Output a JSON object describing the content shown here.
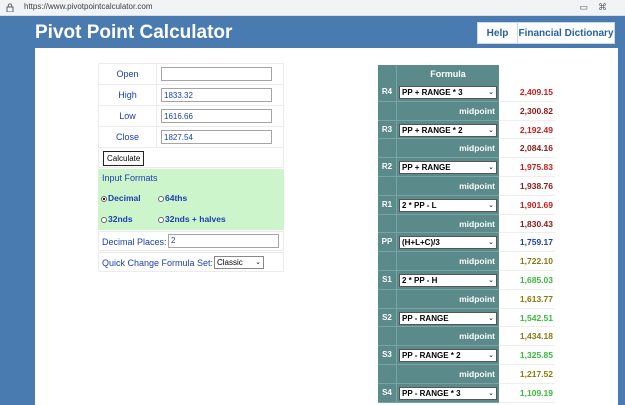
{
  "browser": {
    "url": "https://www.pivotpointcalculator.com"
  },
  "header": {
    "title": "Pivot Point Calculator",
    "nav": [
      "Help",
      "Financial Dictionary"
    ]
  },
  "form": {
    "fields": [
      {
        "label": "Open",
        "value": ""
      },
      {
        "label": "High",
        "value": "1833.32"
      },
      {
        "label": "Low",
        "value": "1616.66"
      },
      {
        "label": "Close",
        "value": "1827.54"
      }
    ],
    "calculate_label": "Calculate",
    "formats_title": "Input Formats",
    "formats": [
      {
        "label": "Decimal",
        "selected": true
      },
      {
        "label": "64ths",
        "selected": false
      },
      {
        "label": "32nds",
        "selected": false
      },
      {
        "label": "32nds + halves",
        "selected": false
      }
    ],
    "decimal_places_label": "Decimal Places:",
    "decimal_places_value": "2",
    "quick_change_label": "Quick Change Formula Set:",
    "quick_change_value": "Classic"
  },
  "pivot": {
    "header": "Formula",
    "midpoint_label": "midpoint",
    "rows": [
      {
        "code": "R4",
        "formula": "PP + RANGE * 3",
        "value": "2,409.15",
        "color": "#c81d1d"
      },
      {
        "mid": true,
        "value": "2,300.82",
        "color": "#8b1a1a"
      },
      {
        "code": "R3",
        "formula": "PP + RANGE * 2",
        "value": "2,192.49",
        "color": "#c81d1d"
      },
      {
        "mid": true,
        "value": "2,084.16",
        "color": "#8b1a1a"
      },
      {
        "code": "R2",
        "formula": "PP + RANGE",
        "value": "1,975.83",
        "color": "#c81d1d"
      },
      {
        "mid": true,
        "value": "1,938.76",
        "color": "#8b1a1a"
      },
      {
        "code": "R1",
        "formula": "2 * PP - L",
        "value": "1,901.69",
        "color": "#c81d1d"
      },
      {
        "mid": true,
        "value": "1,830.43",
        "color": "#8b1a1a"
      },
      {
        "code": "PP",
        "formula": "(H+L+C)/3",
        "value": "1,759.17",
        "color": "#1a3fb5"
      },
      {
        "mid": true,
        "value": "1,722.10",
        "color": "#8a7a10"
      },
      {
        "code": "S1",
        "formula": "2 * PP - H",
        "value": "1,685.03",
        "color": "#3db83d"
      },
      {
        "mid": true,
        "value": "1,613.77",
        "color": "#8a7a10"
      },
      {
        "code": "S2",
        "formula": "PP - RANGE",
        "value": "1,542.51",
        "color": "#3db83d"
      },
      {
        "mid": true,
        "value": "1,434.18",
        "color": "#8a7a10"
      },
      {
        "code": "S3",
        "formula": "PP - RANGE * 2",
        "value": "1,325.85",
        "color": "#3db83d"
      },
      {
        "mid": true,
        "value": "1,217.52",
        "color": "#8a7a10"
      },
      {
        "code": "S4",
        "formula": "PP - RANGE * 3",
        "value": "1,109.19",
        "color": "#3db83d"
      }
    ]
  }
}
